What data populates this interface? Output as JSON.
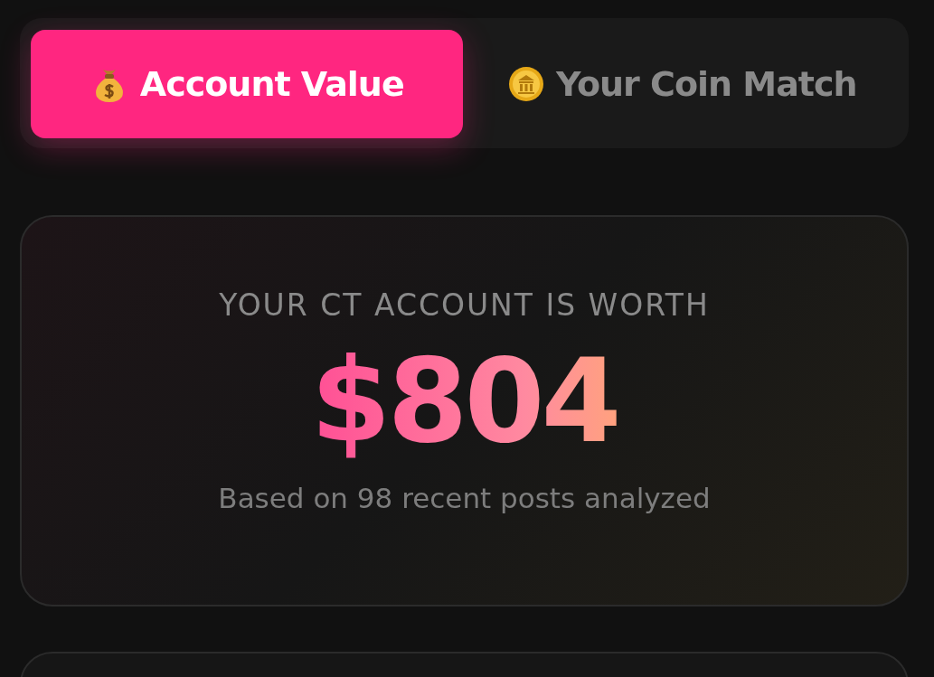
{
  "tabs": [
    {
      "label": "Account Value",
      "selected": true,
      "kind": "money-bag"
    },
    {
      "label": "Your Coin Match",
      "selected": false,
      "kind": "coin"
    }
  ],
  "value_card": {
    "heading": "YOUR CT ACCOUNT IS WORTH",
    "value": "$804",
    "caption": "Based on 98 recent posts analyzed"
  }
}
